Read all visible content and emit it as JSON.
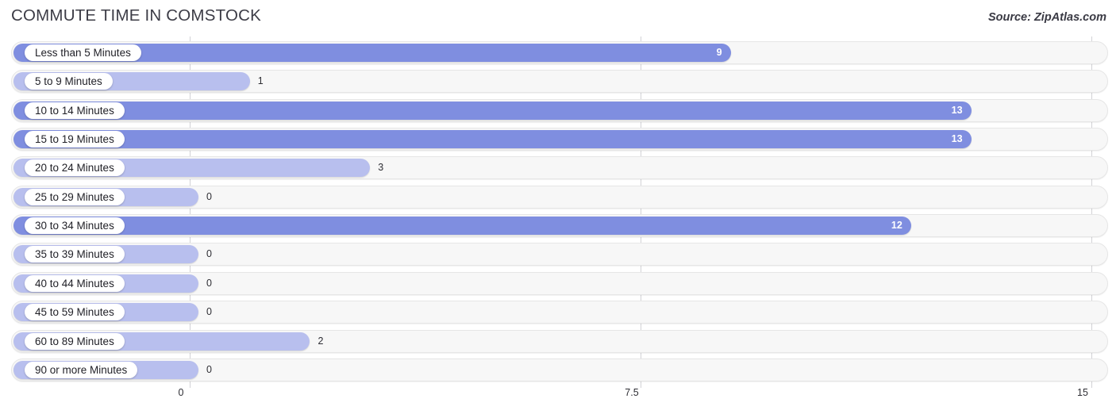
{
  "header": {
    "title": "COMMUTE TIME IN COMSTOCK",
    "source": "Source: ZipAtlas.com"
  },
  "colors": {
    "bar_main": "#7f8ee0",
    "bar_light": "#b8bfee",
    "track": "#f7f7f7",
    "gridline": "#d2d2d6",
    "text": "#2e2e34"
  },
  "chart_data": {
    "type": "bar",
    "orientation": "horizontal",
    "title": "COMMUTE TIME IN COMSTOCK",
    "xlabel": "",
    "ylabel": "",
    "xlim": [
      0,
      15
    ],
    "grid": true,
    "legend": "none",
    "xticks": [
      "0",
      "7.5",
      "15"
    ],
    "xtick_values": [
      0,
      7.5,
      15
    ],
    "categories": [
      "Less than 5 Minutes",
      "5 to 9 Minutes",
      "10 to 14 Minutes",
      "15 to 19 Minutes",
      "20 to 24 Minutes",
      "25 to 29 Minutes",
      "30 to 34 Minutes",
      "35 to 39 Minutes",
      "40 to 44 Minutes",
      "45 to 59 Minutes",
      "60 to 89 Minutes",
      "90 or more Minutes"
    ],
    "values": [
      9,
      1,
      13,
      13,
      3,
      0,
      12,
      0,
      0,
      0,
      2,
      0
    ],
    "value_labels": [
      "9",
      "1",
      "13",
      "13",
      "3",
      "0",
      "12",
      "0",
      "0",
      "0",
      "2",
      "0"
    ]
  },
  "rows": [
    {
      "label": "Less than 5 Minutes",
      "value": 9,
      "value_label": "9",
      "inside": true,
      "light": false
    },
    {
      "label": "5 to 9 Minutes",
      "value": 1,
      "value_label": "1",
      "inside": false,
      "light": true
    },
    {
      "label": "10 to 14 Minutes",
      "value": 13,
      "value_label": "13",
      "inside": true,
      "light": false
    },
    {
      "label": "15 to 19 Minutes",
      "value": 13,
      "value_label": "13",
      "inside": true,
      "light": false
    },
    {
      "label": "20 to 24 Minutes",
      "value": 3,
      "value_label": "3",
      "inside": false,
      "light": true
    },
    {
      "label": "25 to 29 Minutes",
      "value": 0,
      "value_label": "0",
      "inside": false,
      "light": true
    },
    {
      "label": "30 to 34 Minutes",
      "value": 12,
      "value_label": "12",
      "inside": true,
      "light": false
    },
    {
      "label": "35 to 39 Minutes",
      "value": 0,
      "value_label": "0",
      "inside": false,
      "light": true
    },
    {
      "label": "40 to 44 Minutes",
      "value": 0,
      "value_label": "0",
      "inside": false,
      "light": true
    },
    {
      "label": "45 to 59 Minutes",
      "value": 0,
      "value_label": "0",
      "inside": false,
      "light": true
    },
    {
      "label": "60 to 89 Minutes",
      "value": 2,
      "value_label": "2",
      "inside": false,
      "light": true
    },
    {
      "label": "90 or more Minutes",
      "value": 0,
      "value_label": "0",
      "inside": false,
      "light": true
    }
  ],
  "axis": {
    "ticks": [
      {
        "label": "0",
        "value": 0
      },
      {
        "label": "7.5",
        "value": 7.5
      },
      {
        "label": "15",
        "value": 15
      }
    ]
  }
}
